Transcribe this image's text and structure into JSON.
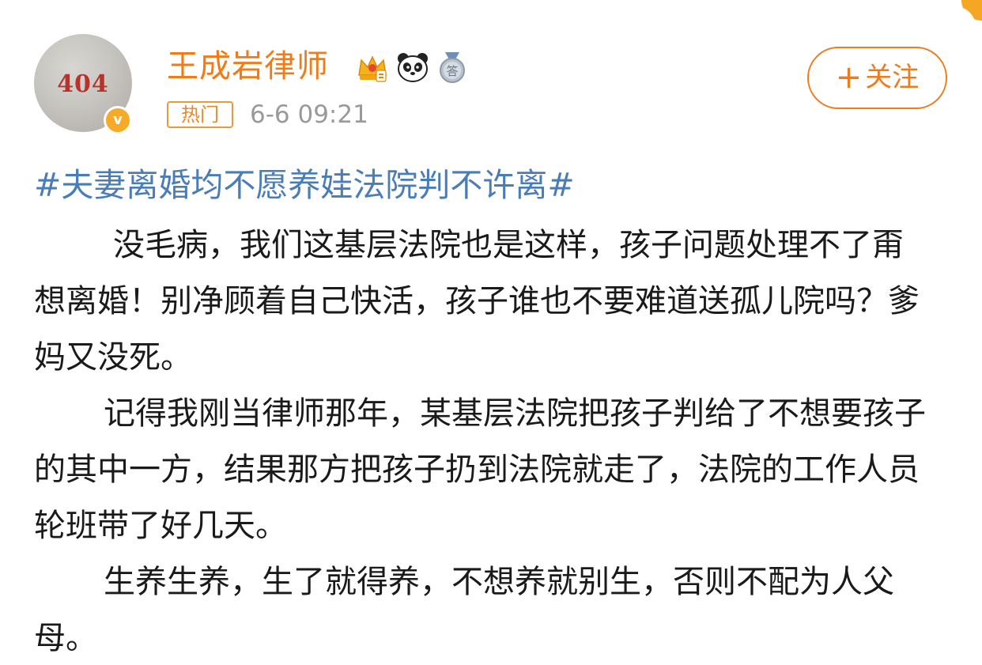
{
  "post": {
    "author": {
      "name": "王成岩律师",
      "avatar_text": "404",
      "verified_mark": "v",
      "badges": [
        "crown-icon",
        "panda-icon",
        "answer-medal-icon"
      ]
    },
    "hot_tag": "热门",
    "timestamp": "6-6 09:21",
    "follow_button": {
      "plus": "+",
      "label": "关注"
    },
    "hashtag": "#夫妻离婚均不愿养娃法院判不许离#",
    "paragraphs": [
      "没毛病，我们这基层法院也是这样，孩子问题处理不了甭想离婚！别净顾着自己快活，孩子谁也不要难道送孤儿院吗？爹妈又没死。",
      "记得我刚当律师那年，某基层法院把孩子判给了不想要孩子的其中一方，结果那方把孩子扔到法院就走了，法院的工作人员轮班带了好几天。",
      "生养生养，生了就得养，不想养就别生，否则不配为人父母。"
    ]
  },
  "colors": {
    "name": "#f27b18",
    "hashtag": "#4a7db8",
    "hot_tag": "#e8892a",
    "timestamp": "#9a9a9a",
    "follow": "#f07b1d",
    "verified": "#f7a928",
    "text": "#1a1a1a"
  }
}
